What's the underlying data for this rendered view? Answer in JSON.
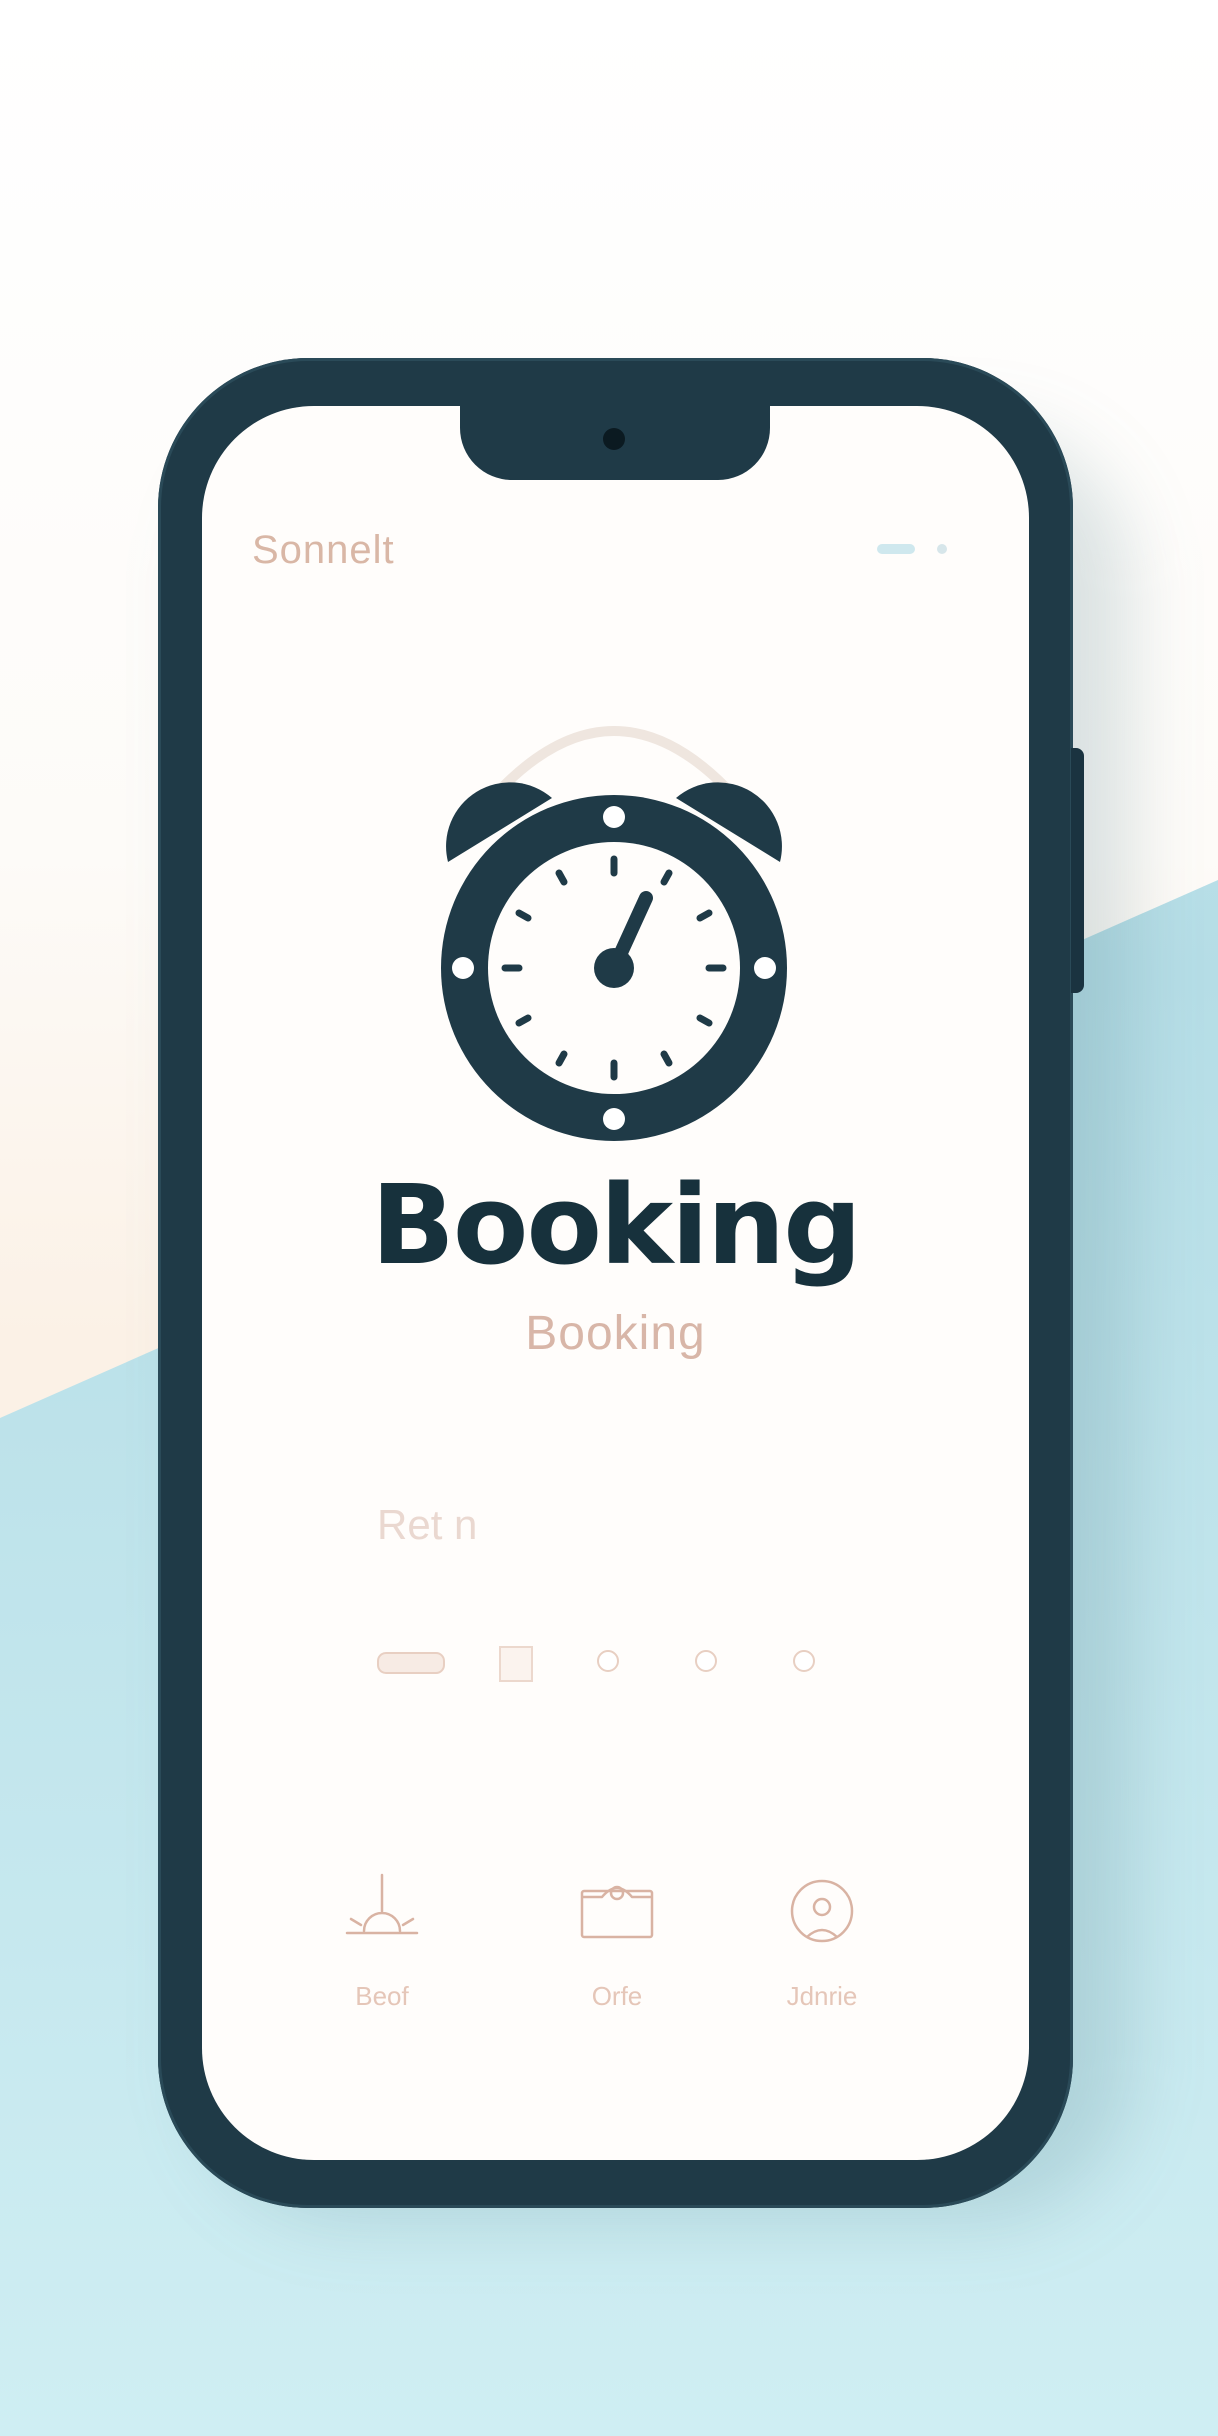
{
  "status_bar": {
    "app_name": "Sonnelt",
    "icons": [
      "signal-icon",
      "battery-icon"
    ]
  },
  "hero": {
    "icon": "alarm-clock-icon",
    "title": "Booking",
    "subtitle": "Booking"
  },
  "section": {
    "label": "Ret n"
  },
  "page_indicators": [
    "pill",
    "square",
    "dot",
    "dot",
    "dot"
  ],
  "tabs": [
    {
      "icon": "sunrise-icon",
      "label": "Beof"
    },
    {
      "icon": "inbox-icon",
      "label": "Orfe"
    },
    {
      "icon": "profile-icon",
      "label": "Jdnrie"
    }
  ],
  "colors": {
    "phone_frame": "#1f3a47",
    "clock_accent": "#1f3a47",
    "title_text": "#17313c",
    "muted_text": "#d8b6a8",
    "backdrop_teal": "#bfe3ea"
  }
}
